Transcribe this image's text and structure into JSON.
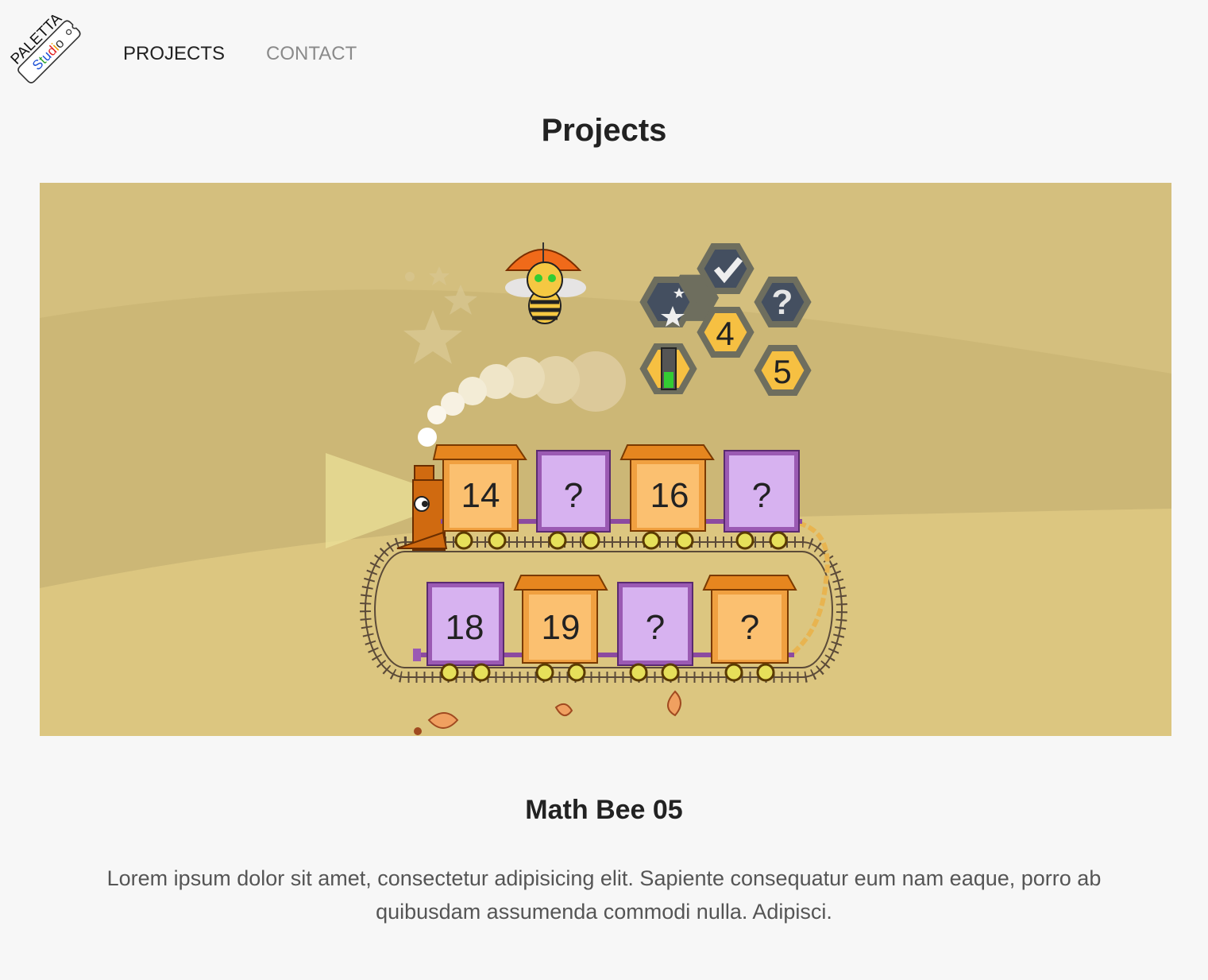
{
  "brand": {
    "logo_line1": "PALETTA",
    "logo_line2": "Studio",
    "logo_colors": [
      "#1a4fd6",
      "#2aa02a",
      "#e02020",
      "#f0a000"
    ]
  },
  "nav": {
    "items": [
      {
        "label": "PROJECTS",
        "active": true
      },
      {
        "label": "CONTACT",
        "active": false
      }
    ]
  },
  "page": {
    "title": "Projects"
  },
  "project": {
    "title": "Math Bee 05",
    "description": "Lorem ipsum dolor sit amet, consectetur adipisicing elit. Sapiente consequatur eum nam eaque, porro ab quibusdam assumenda commodi nulla. Adipisci.",
    "image": {
      "top_train": [
        "14",
        "?",
        "16",
        "?"
      ],
      "bottom_train": [
        "18",
        "19",
        "?",
        "?"
      ],
      "hex_numbers": [
        "4",
        "5"
      ],
      "hex_icons": [
        "check-icon",
        "question-icon",
        "stars-icon",
        "battery-icon"
      ],
      "colors": {
        "background": "#d4bf7e",
        "orange_car": "#f0a040",
        "purple_car": "#c79be0"
      }
    }
  }
}
